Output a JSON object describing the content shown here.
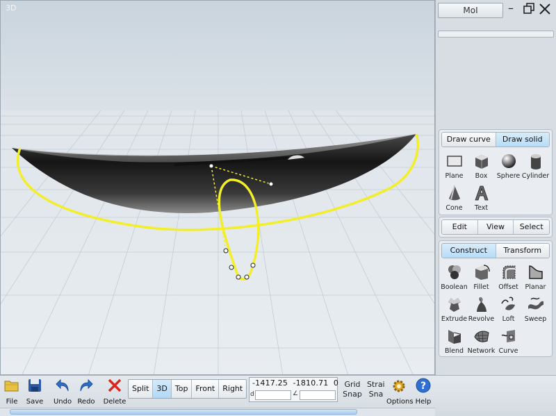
{
  "viewport": {
    "label": "3D"
  },
  "panel": {
    "title_button": "MoI",
    "draw_tabs": [
      "Draw curve",
      "Draw solid"
    ],
    "draw_tools": [
      {
        "label": "Plane",
        "icon": "plane-icon"
      },
      {
        "label": "Box",
        "icon": "box-icon"
      },
      {
        "label": "Sphere",
        "icon": "sphere-icon"
      },
      {
        "label": "Cylinder",
        "icon": "cylinder-icon"
      },
      {
        "label": "Cone",
        "icon": "cone-icon"
      },
      {
        "label": "Text",
        "icon": "text-icon"
      }
    ],
    "edit_tabs": [
      "Edit",
      "View",
      "Select"
    ],
    "construct_tabs": [
      "Construct",
      "Transform"
    ],
    "construct_tools": [
      {
        "label": "Boolean",
        "icon": "boolean-icon"
      },
      {
        "label": "Fillet",
        "icon": "fillet-icon"
      },
      {
        "label": "Offset",
        "icon": "offset-icon"
      },
      {
        "label": "Planar",
        "icon": "planar-icon"
      },
      {
        "label": "Extrude",
        "icon": "extrude-icon"
      },
      {
        "label": "Revolve",
        "icon": "revolve-icon"
      },
      {
        "label": "Loft",
        "icon": "loft-icon"
      },
      {
        "label": "Sweep",
        "icon": "sweep-icon"
      },
      {
        "label": "Blend",
        "icon": "blend-icon"
      },
      {
        "label": "Network",
        "icon": "network-icon"
      },
      {
        "label": "Curve",
        "icon": "curve-icon"
      }
    ]
  },
  "toolbar": {
    "file": "File",
    "save": "Save",
    "undo": "Undo",
    "redo": "Redo",
    "delete": "Delete",
    "views": [
      "Split",
      "3D",
      "Top",
      "Front",
      "Right"
    ],
    "active_view": "3D",
    "coords": "-1417.25  -1810.71  0",
    "distance_label": "d",
    "angle_label": "∠",
    "grid_snap": [
      "Grid",
      "Snap"
    ],
    "straight_snap": [
      "Straig",
      "Sna"
    ],
    "options": "Options",
    "help": "Help"
  },
  "colors": {
    "curve": "#f2ee2a",
    "accent": "#b8dcf6",
    "hull": "#222222"
  }
}
